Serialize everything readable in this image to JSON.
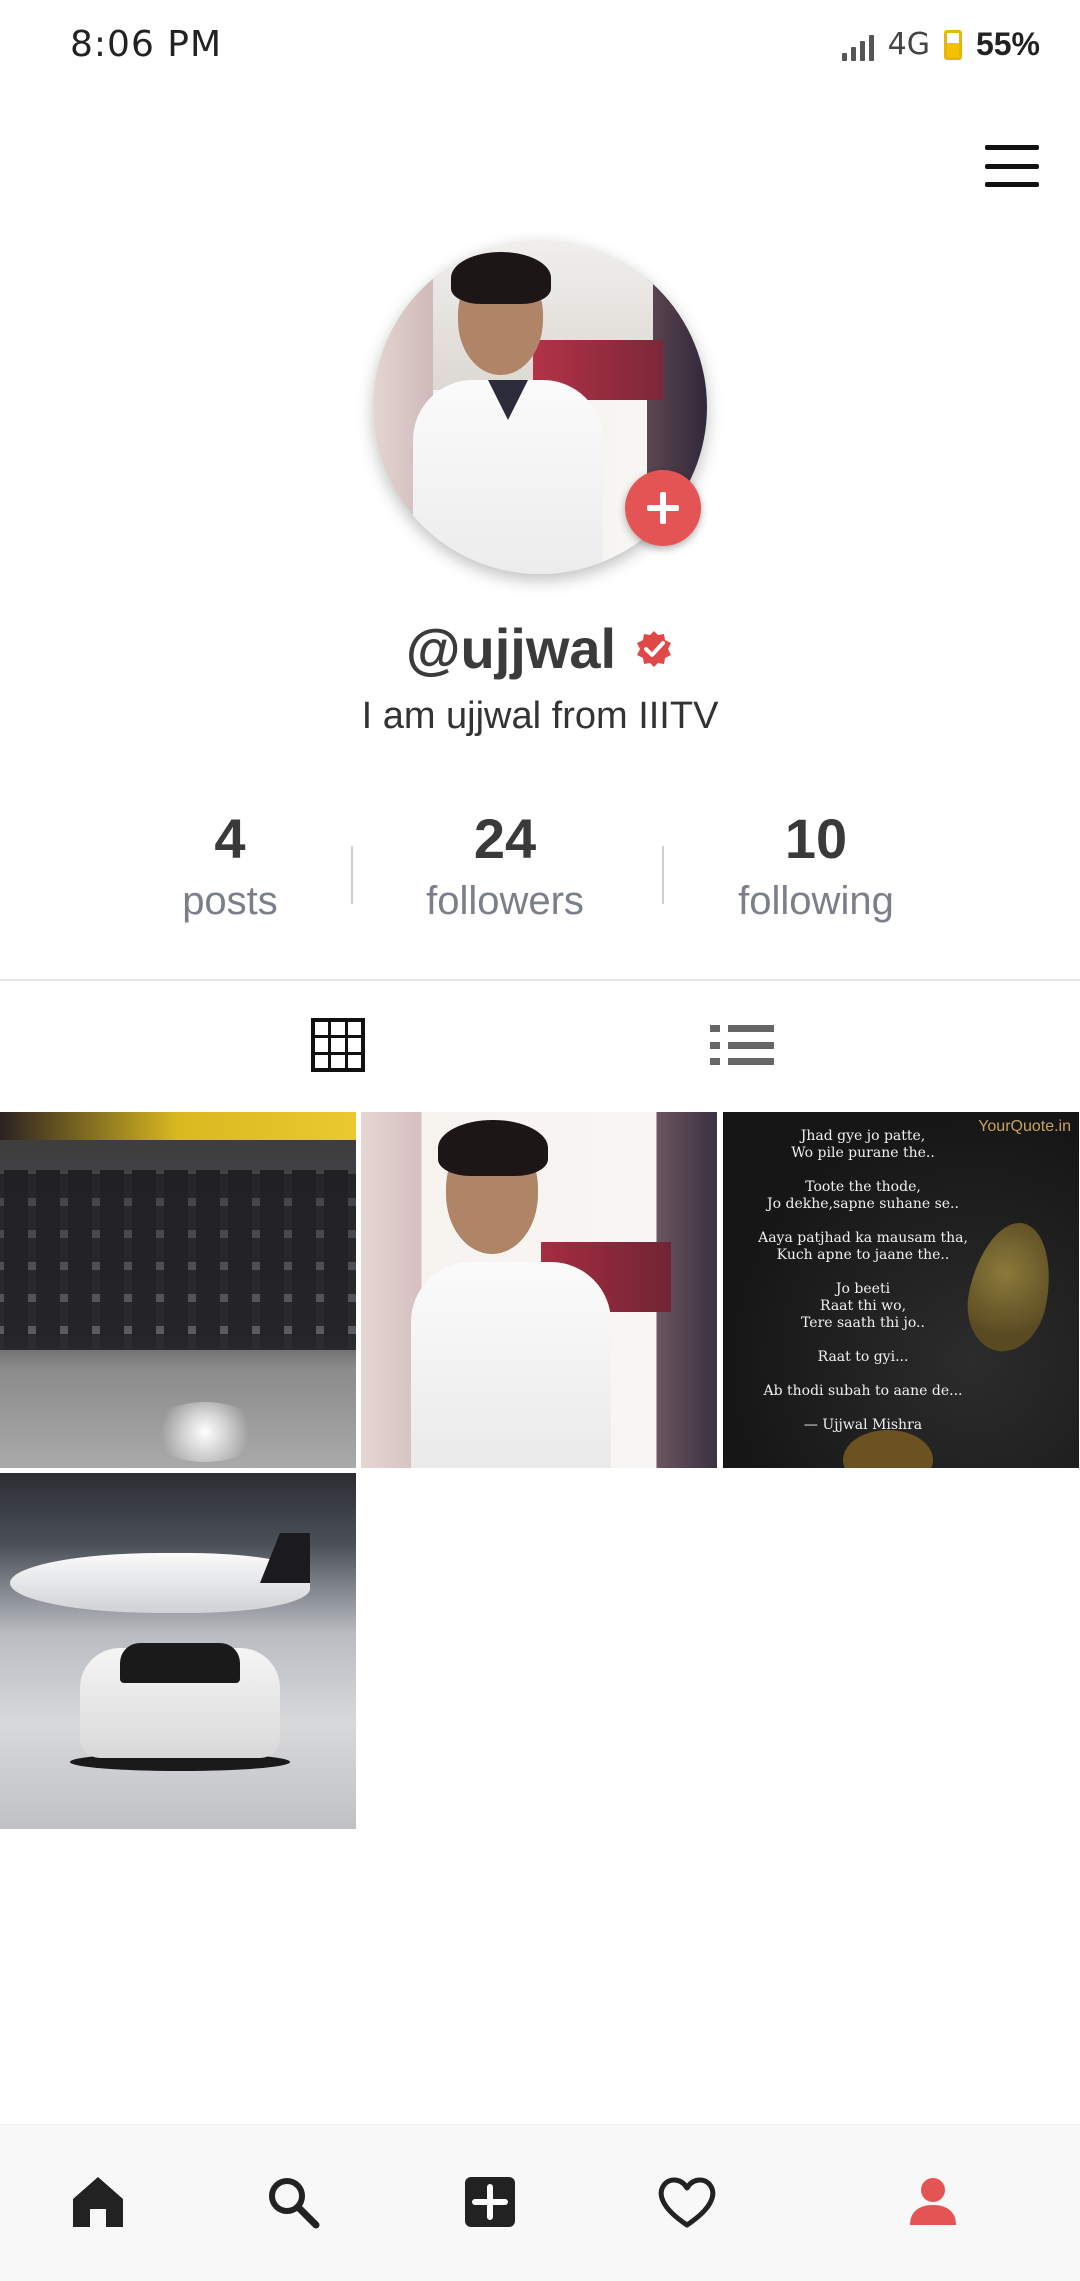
{
  "status_bar": {
    "time": "8:06 PM",
    "network": "4G",
    "battery": "55%"
  },
  "profile": {
    "username": "@ujjwal",
    "bio": "I am ujjwal from IIITV",
    "verified": true
  },
  "stats": [
    {
      "value": "4",
      "label": "posts"
    },
    {
      "value": "24",
      "label": "followers"
    },
    {
      "value": "10",
      "label": "following"
    }
  ],
  "quote_post": {
    "brand": "YourQuote.in",
    "text": "Jhad gye jo patte,\nWo pile purane the..\n\nToote the thode,\nJo dekhe,sapne suhane se..\n\nAaya patjhad ka mausam tha,\nKuch apne to jaane the..\n\nJo beeti\nRaat thi wo,\nTere saath thi jo..\n\nRaat to gyi...\n\nAb thodi subah to aane de...\n\n— Ujjwal Mishra"
  },
  "colors": {
    "accent": "#e55454",
    "verified": "#e04848",
    "stat_label": "#7a7f89"
  },
  "icons": {
    "tab_grid": "grid-icon",
    "tab_list": "list-icon",
    "nav": [
      "home-icon",
      "search-icon",
      "add-post-icon",
      "heart-icon",
      "profile-icon"
    ]
  }
}
